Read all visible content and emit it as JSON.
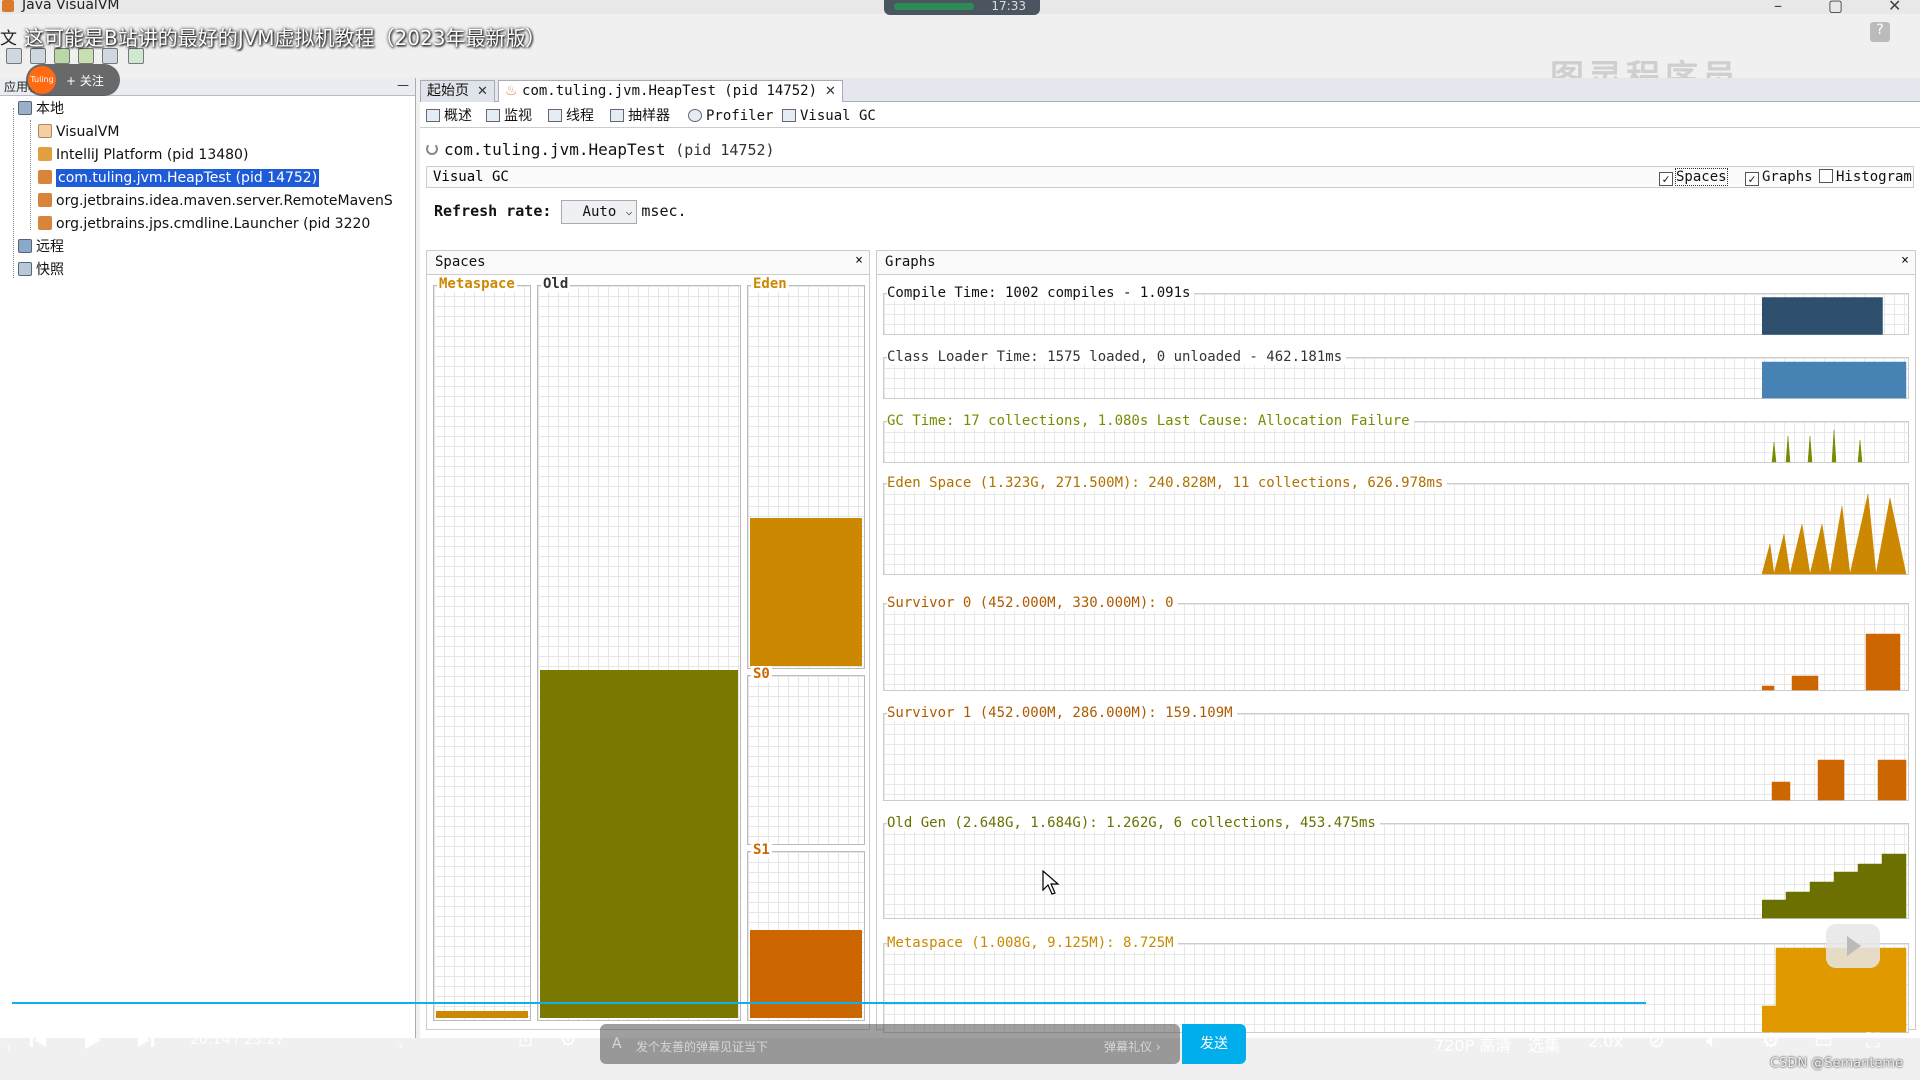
{
  "window": {
    "title": "Java VisualVM",
    "clock": "17:33"
  },
  "video": {
    "title": "这可能是B站讲的最好的JVM虚拟机教程（2023年最新版）",
    "uploader_follow": "+ 关注",
    "uploader_avatar_text": "Tuling",
    "watermark": "图灵程序员",
    "time_current": "20:14",
    "time_total": "23:27",
    "time_sep": " / ",
    "danmaku_placeholder": "发个友善的弹幕见证当下",
    "danmaku_etiquette": "弹幕礼仪 ›",
    "send_label": "发送",
    "quality": "720P 高清",
    "episodes": "选集",
    "speed": "2.0x",
    "credit": "CSDN @Semanteme"
  },
  "menu_stub": "文",
  "left_panel": {
    "header": "应用程序",
    "items": [
      {
        "label": "本地",
        "level": 0
      },
      {
        "label": "VisualVM",
        "level": 1
      },
      {
        "label": "IntelliJ Platform (pid 13480)",
        "level": 1
      },
      {
        "label": "com.tuling.jvm.HeapTest (pid 14752)",
        "level": 1,
        "selected": true
      },
      {
        "label": "org.jetbrains.idea.maven.server.RemoteMavenS",
        "level": 1
      },
      {
        "label": "org.jetbrains.jps.cmdline.Launcher (pid 3220",
        "level": 1
      },
      {
        "label": "远程",
        "level": 0
      },
      {
        "label": "快照",
        "level": 0
      }
    ]
  },
  "doc_tabs": [
    {
      "label": "起始页"
    },
    {
      "label": "com.tuling.jvm.HeapTest (pid 14752)"
    }
  ],
  "sub_tabs": [
    "概述",
    "监视",
    "线程",
    "抽样器",
    "Profiler",
    "Visual GC"
  ],
  "process": {
    "name": "com.tuling.jvm.HeapTest",
    "pid": "(pid 14752)"
  },
  "visual_gc": {
    "label": "Visual GC",
    "checkboxes": [
      {
        "label": "Spaces",
        "checked": true
      },
      {
        "label": "Graphs",
        "checked": true
      },
      {
        "label": "Histogram",
        "checked": false
      }
    ],
    "refresh_label": "Refresh rate:",
    "refresh_value": "Auto",
    "refresh_unit": "msec."
  },
  "spaces": {
    "title": "Spaces",
    "close": "×",
    "boxes": [
      {
        "label": "Metaspace",
        "fill_fraction": 0.01,
        "color": "#cc8800"
      },
      {
        "label": "Old",
        "fill_fraction": 0.476,
        "color": "#7a7800"
      },
      {
        "label": "Eden",
        "fill_fraction": 0.39,
        "color": "#cc8800"
      },
      {
        "label": "S0",
        "fill_fraction": 0.0,
        "color": "#cc6600"
      },
      {
        "label": "S1",
        "fill_fraction": 0.53,
        "color": "#cc6600"
      }
    ]
  },
  "graphs": {
    "title": "Graphs",
    "close": "×",
    "rows": [
      {
        "title": "Compile Time: 1002 compiles - 1.091s",
        "color": "#2f4f6f",
        "title_color": "#111"
      },
      {
        "title": "Class Loader Time: 1575 loaded, 0 unloaded - 462.181ms",
        "color": "#4682b4",
        "title_color": "#333"
      },
      {
        "title": "GC Time: 17 collections, 1.080s  Last Cause: Allocation Failure",
        "color": "#7a8a00",
        "title_color": "#7a8a00"
      },
      {
        "title": "Eden Space (1.323G, 271.500M): 240.828M, 11 collections, 626.978ms",
        "color": "#cc8800",
        "title_color": "#b07000"
      },
      {
        "title": "Survivor 0 (452.000M, 330.000M): 0",
        "color": "#cc6600",
        "title_color": "#b05a00"
      },
      {
        "title": "Survivor 1 (452.000M, 286.000M): 159.109M",
        "color": "#cc6600",
        "title_color": "#b05a00"
      },
      {
        "title": "Old Gen (2.648G, 1.684G): 1.262G, 6 collections, 453.475ms",
        "color": "#6b7000",
        "title_color": "#6b7000"
      },
      {
        "title": "Metaspace (1.008G, 9.125M): 8.725M",
        "color": "#e09a00",
        "title_color": "#c88a00"
      }
    ]
  },
  "colors": {
    "selection": "#1e5bd8",
    "progress": "#00aeec",
    "send": "#00aeec"
  }
}
